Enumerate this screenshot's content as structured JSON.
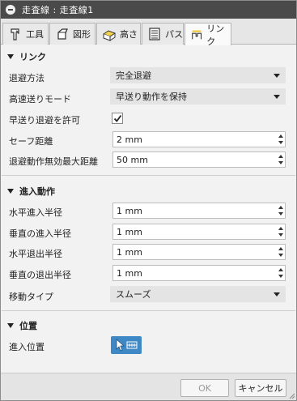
{
  "window": {
    "title": "走査線 : 走査線1"
  },
  "tabs": [
    {
      "label": "工具",
      "icon": "tool-icon"
    },
    {
      "label": "図形",
      "icon": "geometry-icon"
    },
    {
      "label": "高さ",
      "icon": "heights-icon"
    },
    {
      "label": "パス",
      "icon": "passes-icon"
    },
    {
      "label": "リンク",
      "icon": "linking-icon"
    }
  ],
  "active_tab": "リンク",
  "linking": {
    "header": "リンク",
    "retraction_policy": {
      "label": "退避方法",
      "value": "完全退避"
    },
    "high_feedrate_mode": {
      "label": "高速送りモード",
      "value": "早送り動作を保持"
    },
    "allow_rapid_retract": {
      "label": "早送り退避を許可",
      "checked": true
    },
    "safe_distance": {
      "label": "セーフ距離",
      "value": "2 mm"
    },
    "max_stay_down": {
      "label": "退避動作無効最大距離",
      "value": "50 mm"
    }
  },
  "leads": {
    "header": "進入動作",
    "horizontal_lead_in_radius": {
      "label": "水平進入半径",
      "value": "1 mm"
    },
    "vertical_lead_in_radius": {
      "label": "垂直の進入半径",
      "value": "1 mm"
    },
    "horizontal_lead_out_radius": {
      "label": "水平退出半径",
      "value": "1 mm"
    },
    "vertical_lead_out_radius": {
      "label": "垂直の退出半径",
      "value": "1 mm"
    },
    "transition_type": {
      "label": "移動タイプ",
      "value": "スムーズ"
    }
  },
  "positions": {
    "header": "位置",
    "entry_positions": {
      "label": "進入位置",
      "icon": "select-point-icon"
    }
  },
  "footer": {
    "ok_label": "OK",
    "cancel_label": "キャンセル"
  },
  "colors": {
    "titlebar": "#4a4a4a",
    "accent": "#3e88c6",
    "panel": "#f2f2f2"
  }
}
